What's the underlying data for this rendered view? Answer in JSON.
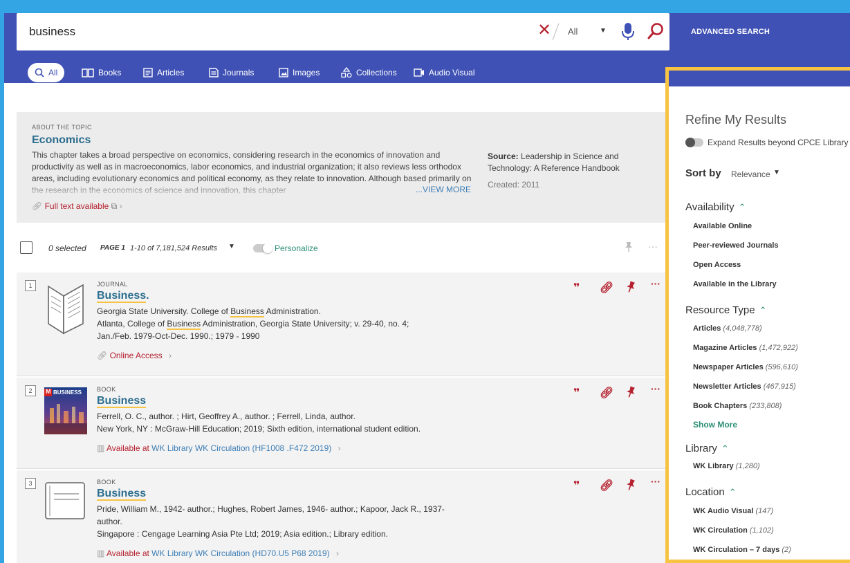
{
  "search": {
    "query": "business",
    "scope": "All",
    "advanced_label": "ADVANCED SEARCH"
  },
  "tabs": [
    {
      "label": "All",
      "icon": "search-icon"
    },
    {
      "label": "Books",
      "icon": "book-open-icon"
    },
    {
      "label": "Articles",
      "icon": "article-icon"
    },
    {
      "label": "Journals",
      "icon": "journal-icon"
    },
    {
      "label": "Images",
      "icon": "image-icon"
    },
    {
      "label": "Collections",
      "icon": "collections-icon"
    },
    {
      "label": "Audio Visual",
      "icon": "video-icon"
    }
  ],
  "topic": {
    "eyebrow": "ABOUT THE TOPIC",
    "title": "Economics",
    "body": "This chapter takes a broad perspective on economics, considering research in the economics of innovation and productivity as well as in macroeconomics, labor economics, and industrial organization; it also reviews less orthodox areas, including evolutionary economics and political economy, as they relate to innovation. Although based primarily on the research in the economics of science and innovation, this chapter",
    "view_more": "...VIEW MORE",
    "source_label": "Source:",
    "source_value": "Leadership in Science and Technology: A Reference Handbook",
    "created": "Created: 2011",
    "fulltext": "Full text available"
  },
  "results_bar": {
    "selected": "0 selected",
    "page": "PAGE 1",
    "count": "1-10 of 7,181,524 Results",
    "personalize": "Personalize"
  },
  "results": [
    {
      "num": "1",
      "type": "JOURNAL",
      "title": "Business",
      "title_suffix": ".",
      "line1_a": "Georgia State University. College of ",
      "line1_hl": "Business",
      "line1_b": " Administration.",
      "line2_a": "Atlanta, College of ",
      "line2_hl": "Business",
      "line2_b": " Administration, Georgia State University; v. 29-40, no. 4;",
      "line3": "Jan./Feb. 1979-Oct-Dec. 1990.; 1979 - 1990",
      "access": "Online Access"
    },
    {
      "num": "2",
      "type": "BOOK",
      "title": "Business",
      "line1": "Ferrell, O. C., author. ; Hirt, Geoffrey A., author. ; Ferrell, Linda, author.",
      "line2": "New York, NY : McGraw-Hill Education; 2019; Sixth edition, international student edition.",
      "access_a": "Available at ",
      "access_b": "WK Library  WK Circulation (HF1008 .F472 2019)",
      "cover_text": "BUSINESS",
      "cover_badge": "M"
    },
    {
      "num": "3",
      "type": "BOOK",
      "title": "Business",
      "line1": "Pride, William M., 1942- author.; Hughes, Robert James, 1946- author.; Kapoor, Jack R., 1937-",
      "line2": "author.",
      "line3": "Singapore : Cengage Learning Asia Pte Ltd; 2019; Asia edition.; Library edition.",
      "access_a": "Available at ",
      "access_b": "WK Library  WK Circulation (HD70.U5 P68 2019)"
    }
  ],
  "refine": {
    "title": "Refine My Results",
    "expand": "Expand Results beyond CPCE Library",
    "sort_label": "Sort by",
    "sort_value": "Relevance",
    "availability": {
      "heading": "Availability",
      "items": [
        "Available Online",
        "Peer-reviewed Journals",
        "Open Access",
        "Available in the Library"
      ]
    },
    "resource_type": {
      "heading": "Resource Type",
      "items": [
        {
          "label": "Articles",
          "count": "(4,048,778)"
        },
        {
          "label": "Magazine Articles",
          "count": "(1,472,922)"
        },
        {
          "label": "Newspaper Articles",
          "count": "(596,610)"
        },
        {
          "label": "Newsletter Articles",
          "count": "(467,915)"
        },
        {
          "label": "Book Chapters",
          "count": "(233,808)"
        }
      ],
      "show_more": "Show More"
    },
    "library": {
      "heading": "Library",
      "items": [
        {
          "label": "WK Library",
          "count": "(1,280)"
        }
      ]
    },
    "location": {
      "heading": "Location",
      "items": [
        {
          "label": "WK Audio Visual",
          "count": "(147)"
        },
        {
          "label": "WK Circulation",
          "count": "(1,102)"
        },
        {
          "label": "WK Circulation – 7 days",
          "count": "(2)"
        }
      ]
    }
  },
  "colors": {
    "frame_blue": "#33a5e5",
    "header_indigo": "#3f51b5",
    "accent_red": "#b5212f",
    "link_teal": "#2c6e8e",
    "highlight_yellow": "#f6c343",
    "facet_green": "#2b8d74"
  }
}
